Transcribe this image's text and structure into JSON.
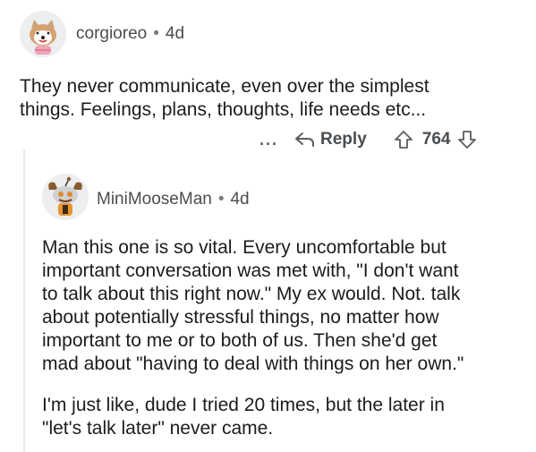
{
  "comment": {
    "username": "corgioreo",
    "age": "4d",
    "body_lines": [
      "They never communicate, even over the simplest",
      "things. Feelings, plans, thoughts, life needs etc..."
    ],
    "more_label": "...",
    "reply_label": "Reply",
    "votes": "764"
  },
  "reply": {
    "username": "MiniMooseMan",
    "age": "4d",
    "paragraph1_lines": [
      "Man this one is so vital. Every uncomfortable but",
      "important conversation was met with, \"I don't want",
      "to talk about this right now.\" My ex would. Not. talk",
      "about potentially stressful things, no matter how",
      "important to me or to both of us. Then she'd get",
      "mad about \"having to deal with things on her own.\""
    ],
    "paragraph2_lines": [
      "I'm just like, dude I tried 20 times, but the later in",
      "\"let's talk later\" never came."
    ]
  },
  "icons": {
    "reply": "reply-arrow-icon",
    "upvote": "upvote-arrow-icon",
    "downvote": "downvote-arrow-icon",
    "more": "more-dots-icon"
  }
}
